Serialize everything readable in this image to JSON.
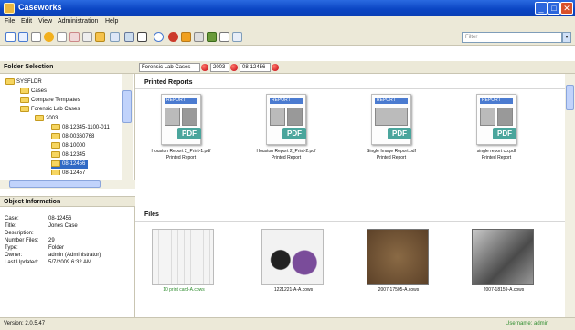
{
  "window": {
    "title": "Caseworks"
  },
  "menu": {
    "items": [
      "File",
      "Edit",
      "View",
      "Administration",
      "Help"
    ]
  },
  "toolbar": {
    "filter_placeholder": "Filter"
  },
  "folder_panel": {
    "header": "Folder Selection",
    "tree": [
      {
        "label": "SYSFLDR"
      },
      {
        "label": "Cases"
      },
      {
        "label": "Compare Templates"
      },
      {
        "label": "Forensic Lab Cases"
      },
      {
        "label": "2003"
      },
      {
        "label": "08-12345-1100-011"
      },
      {
        "label": "08-00360768"
      },
      {
        "label": "08-10000"
      },
      {
        "label": "08-12345"
      },
      {
        "label": "08-12456"
      },
      {
        "label": "08-12457"
      }
    ]
  },
  "breadcrumb": [
    "Forensic Lab Cases",
    "2003",
    "08-12456"
  ],
  "object_info": {
    "header": "Object Information",
    "rows": [
      {
        "label": "Case:",
        "value": "08-12456"
      },
      {
        "label": "Title:",
        "value": "Jones Case"
      },
      {
        "label": "Description:",
        "value": ""
      },
      {
        "label": "Number Files:",
        "value": "29"
      },
      {
        "label": "Type:",
        "value": "Folder"
      },
      {
        "label": "Owner:",
        "value": "admin (Administrator)"
      },
      {
        "label": "Last Updated:",
        "value": "5/7/2009 6:32 AM"
      }
    ]
  },
  "printed_reports": {
    "header": "Printed Reports",
    "items": [
      {
        "name": "Houston Report 2_Print-1.pdf",
        "type": "Printed Report"
      },
      {
        "name": "Houston Report 2_Print-2.pdf",
        "type": "Printed Report"
      },
      {
        "name": "Single Image Report.pdf",
        "type": "Printed Report"
      },
      {
        "name": "single report cb.pdf",
        "type": "Printed Report"
      }
    ],
    "tag": "REPORT",
    "badge": "PDF"
  },
  "files": {
    "header": "Files",
    "items": [
      {
        "name": "10 print card-A.cows",
        "color": "#2d8c2d"
      },
      {
        "name": "1221221-A-A.cows",
        "color": "#111111"
      },
      {
        "name": "2007-17505-A.cows",
        "color": "#111111"
      },
      {
        "name": "2007-18159-A.cows",
        "color": "#111111"
      }
    ]
  },
  "status": {
    "version": "Version: 2.0.5.47",
    "user": "Username: admin"
  },
  "colors": {
    "title_blue": "#0b46c4",
    "selection": "#316ac5",
    "crumb_dot": "#c2000f",
    "pdf_badge": "#4aa59c"
  }
}
